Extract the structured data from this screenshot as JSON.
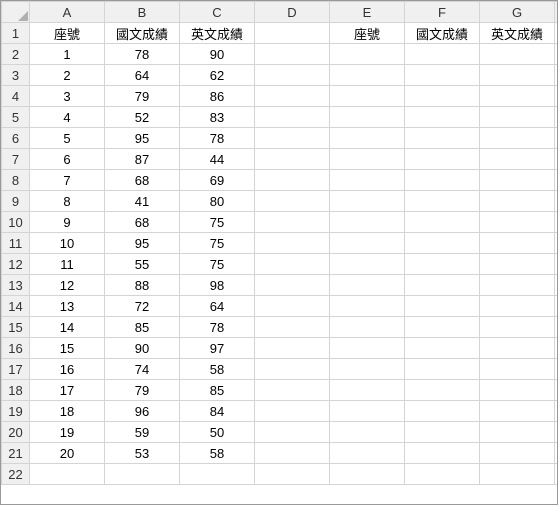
{
  "columns": [
    "A",
    "B",
    "C",
    "D",
    "E",
    "F",
    "G"
  ],
  "row_count": 22,
  "headers_left": {
    "A": "座號",
    "B": "國文成績",
    "C": "英文成績"
  },
  "headers_right": {
    "E": "座號",
    "F": "國文成績",
    "G": "英文成績"
  },
  "rows": [
    {
      "seat": "1",
      "chinese": "78",
      "english": "90"
    },
    {
      "seat": "2",
      "chinese": "64",
      "english": "62"
    },
    {
      "seat": "3",
      "chinese": "79",
      "english": "86"
    },
    {
      "seat": "4",
      "chinese": "52",
      "english": "83"
    },
    {
      "seat": "5",
      "chinese": "95",
      "english": "78"
    },
    {
      "seat": "6",
      "chinese": "87",
      "english": "44"
    },
    {
      "seat": "7",
      "chinese": "68",
      "english": "69"
    },
    {
      "seat": "8",
      "chinese": "41",
      "english": "80"
    },
    {
      "seat": "9",
      "chinese": "68",
      "english": "75"
    },
    {
      "seat": "10",
      "chinese": "95",
      "english": "75"
    },
    {
      "seat": "11",
      "chinese": "55",
      "english": "75"
    },
    {
      "seat": "12",
      "chinese": "88",
      "english": "98"
    },
    {
      "seat": "13",
      "chinese": "72",
      "english": "64"
    },
    {
      "seat": "14",
      "chinese": "85",
      "english": "78"
    },
    {
      "seat": "15",
      "chinese": "90",
      "english": "97"
    },
    {
      "seat": "16",
      "chinese": "74",
      "english": "58"
    },
    {
      "seat": "17",
      "chinese": "79",
      "english": "85"
    },
    {
      "seat": "18",
      "chinese": "96",
      "english": "84"
    },
    {
      "seat": "19",
      "chinese": "59",
      "english": "50"
    },
    {
      "seat": "20",
      "chinese": "53",
      "english": "58"
    }
  ]
}
